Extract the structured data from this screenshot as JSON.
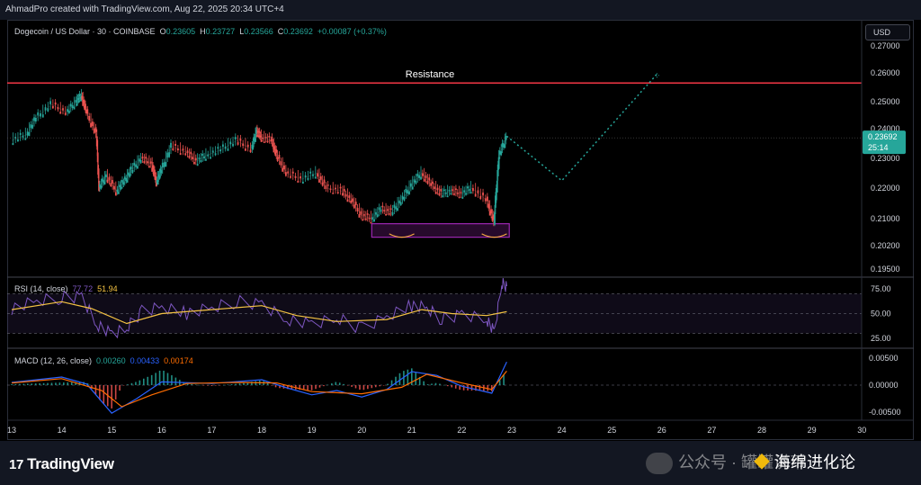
{
  "header": {
    "attribution": "AhmadPro created with TradingView.com, Aug 22, 2025 20:34 UTC+4"
  },
  "main_legend": {
    "title": "Dogecoin / US Dollar · 30 · COINBASE",
    "o_label": "O",
    "o_value": "0.23605",
    "h_label": "H",
    "h_value": "0.23727",
    "l_label": "L",
    "l_value": "0.23566",
    "c_label": "C",
    "c_value": "0.23692",
    "change": "+0.00087 (+0.37%)"
  },
  "currency_button": "USD",
  "resistance_label": "Resistance",
  "price_axis": {
    "ticks": [
      "0.27000",
      "0.26000",
      "0.25000",
      "0.24000",
      "0.23000",
      "0.22000",
      "0.21000",
      "0.20200",
      "0.19500"
    ],
    "current_price": "0.23692",
    "countdown": "25:14"
  },
  "rsi": {
    "label": "RSI (14, close)",
    "value1": "77.72",
    "value2": "51.94",
    "ticks": [
      "75.00",
      "50.00",
      "25.00"
    ]
  },
  "macd": {
    "label": "MACD (12, 26, close)",
    "v1": "0.00260",
    "v2": "0.00433",
    "v3": "0.00174",
    "ticks": [
      "0.00500",
      "0.00000",
      "-0.00500"
    ]
  },
  "time_axis": [
    "13",
    "14",
    "15",
    "16",
    "17",
    "18",
    "19",
    "20",
    "21",
    "22",
    "23",
    "24",
    "25",
    "26",
    "27",
    "28",
    "29",
    "30"
  ],
  "branding": {
    "logo": "TradingView"
  },
  "watermark": {
    "text1": "公众号 · 罐罐说币",
    "text2": "海绵进化论"
  },
  "colors": {
    "up": "#26a69a",
    "down": "#ef5350",
    "resistance": "#f23645",
    "rsi": "#7e57c2",
    "rsi_ma": "#f5c343",
    "macd": "#2962ff",
    "signal": "#ff6d00",
    "projection": "#26a69a",
    "zone": "#9c27b0"
  },
  "chart_data": {
    "type": "line",
    "title": "Dogecoin / US Dollar · 30 · COINBASE",
    "x_unit": "day (Aug)",
    "xlim": [
      13,
      30
    ],
    "ylim": [
      0.195,
      0.27
    ],
    "log_scale": false,
    "grid": false,
    "series": [
      {
        "values": [
          [
            13.0,
            0.236
          ],
          [
            13.3,
            0.238
          ],
          [
            13.5,
            0.244
          ],
          [
            13.8,
            0.249
          ],
          [
            14.1,
            0.246
          ],
          [
            14.3,
            0.25
          ],
          [
            14.4,
            0.252
          ],
          [
            14.5,
            0.246
          ],
          [
            14.7,
            0.238
          ],
          [
            14.75,
            0.22
          ],
          [
            14.9,
            0.224
          ],
          [
            15.1,
            0.219
          ],
          [
            15.25,
            0.222
          ],
          [
            15.4,
            0.226
          ],
          [
            15.6,
            0.23
          ],
          [
            15.8,
            0.228
          ],
          [
            15.9,
            0.222
          ],
          [
            16.0,
            0.226
          ],
          [
            16.2,
            0.234
          ],
          [
            16.5,
            0.232
          ],
          [
            16.7,
            0.229
          ],
          [
            16.9,
            0.231
          ],
          [
            17.2,
            0.233
          ],
          [
            17.5,
            0.236
          ],
          [
            17.8,
            0.233
          ],
          [
            17.9,
            0.239
          ],
          [
            18.0,
            0.237
          ],
          [
            18.2,
            0.236
          ],
          [
            18.3,
            0.231
          ],
          [
            18.5,
            0.225
          ],
          [
            18.8,
            0.223
          ],
          [
            19.1,
            0.225
          ],
          [
            19.3,
            0.22
          ],
          [
            19.6,
            0.219
          ],
          [
            19.8,
            0.216
          ],
          [
            20.0,
            0.211
          ],
          [
            20.2,
            0.21
          ],
          [
            20.4,
            0.213
          ],
          [
            20.6,
            0.212
          ],
          [
            20.8,
            0.216
          ],
          [
            21.0,
            0.221
          ],
          [
            21.2,
            0.225
          ],
          [
            21.4,
            0.221
          ],
          [
            21.6,
            0.218
          ],
          [
            21.8,
            0.219
          ],
          [
            22.0,
            0.218
          ],
          [
            22.2,
            0.22
          ],
          [
            22.5,
            0.216
          ],
          [
            22.65,
            0.209
          ],
          [
            22.75,
            0.231
          ],
          [
            22.9,
            0.23692
          ]
        ]
      },
      {
        "name": "Resistance",
        "values": [
          [
            13.0,
            0.2565
          ],
          [
            30.0,
            0.2565
          ]
        ]
      },
      {
        "values": [
          [
            22.9,
            0.2375
          ],
          [
            24.0,
            0.2225
          ],
          [
            25.9,
            0.2595
          ]
        ]
      }
    ],
    "support_zone": {
      "x": [
        20.2,
        22.95
      ],
      "y": [
        0.2045,
        0.2085
      ]
    },
    "rsi_panel": {
      "ylim": [
        15,
        85
      ],
      "levels": [
        70,
        50,
        30
      ],
      "rsi_values": [
        [
          13,
          55
        ],
        [
          13.5,
          62
        ],
        [
          14,
          66
        ],
        [
          14.4,
          68
        ],
        [
          14.7,
          40
        ],
        [
          15,
          28
        ],
        [
          15.3,
          35
        ],
        [
          15.6,
          52
        ],
        [
          16,
          58
        ],
        [
          16.5,
          50
        ],
        [
          17,
          55
        ],
        [
          17.5,
          62
        ],
        [
          18,
          60
        ],
        [
          18.5,
          45
        ],
        [
          19,
          38
        ],
        [
          19.5,
          45
        ],
        [
          20,
          35
        ],
        [
          20.5,
          48
        ],
        [
          21,
          58
        ],
        [
          21.3,
          55
        ],
        [
          21.6,
          44
        ],
        [
          22,
          50
        ],
        [
          22.5,
          45
        ],
        [
          22.65,
          30
        ],
        [
          22.8,
          80
        ],
        [
          22.9,
          77.72
        ]
      ],
      "ma_values": [
        [
          13,
          54
        ],
        [
          14,
          62
        ],
        [
          14.6,
          55
        ],
        [
          15.3,
          40
        ],
        [
          16,
          50
        ],
        [
          17,
          54
        ],
        [
          18,
          58
        ],
        [
          18.7,
          48
        ],
        [
          19.5,
          42
        ],
        [
          20.5,
          44
        ],
        [
          21.2,
          54
        ],
        [
          21.8,
          50
        ],
        [
          22.5,
          48
        ],
        [
          22.9,
          51.94
        ]
      ]
    },
    "macd_panel": {
      "ylim": [
        -0.0065,
        0.0065
      ],
      "macd_values": [
        [
          13,
          0.0005
        ],
        [
          14,
          0.0015
        ],
        [
          14.5,
          0.0002
        ],
        [
          15,
          -0.0052
        ],
        [
          15.5,
          -0.0025
        ],
        [
          16,
          0.0006
        ],
        [
          17,
          0.0003
        ],
        [
          18,
          0.001
        ],
        [
          18.5,
          -0.0005
        ],
        [
          19,
          -0.0018
        ],
        [
          19.5,
          -0.001
        ],
        [
          20,
          -0.0022
        ],
        [
          20.5,
          -0.0008
        ],
        [
          21,
          0.0025
        ],
        [
          21.5,
          0.0018
        ],
        [
          22,
          -0.0002
        ],
        [
          22.6,
          -0.0015
        ],
        [
          22.9,
          0.0043
        ]
      ],
      "signal_values": [
        [
          13,
          0.0004
        ],
        [
          14,
          0.0012
        ],
        [
          14.8,
          -0.001
        ],
        [
          15.2,
          -0.004
        ],
        [
          15.8,
          -0.0018
        ],
        [
          16.5,
          0.0003
        ],
        [
          17.5,
          0.0005
        ],
        [
          18.3,
          0.0004
        ],
        [
          19,
          -0.0012
        ],
        [
          20,
          -0.0016
        ],
        [
          20.8,
          -0.0004
        ],
        [
          21.3,
          0.002
        ],
        [
          22,
          0.0004
        ],
        [
          22.6,
          -0.0008
        ],
        [
          22.9,
          0.0026
        ]
      ]
    }
  }
}
